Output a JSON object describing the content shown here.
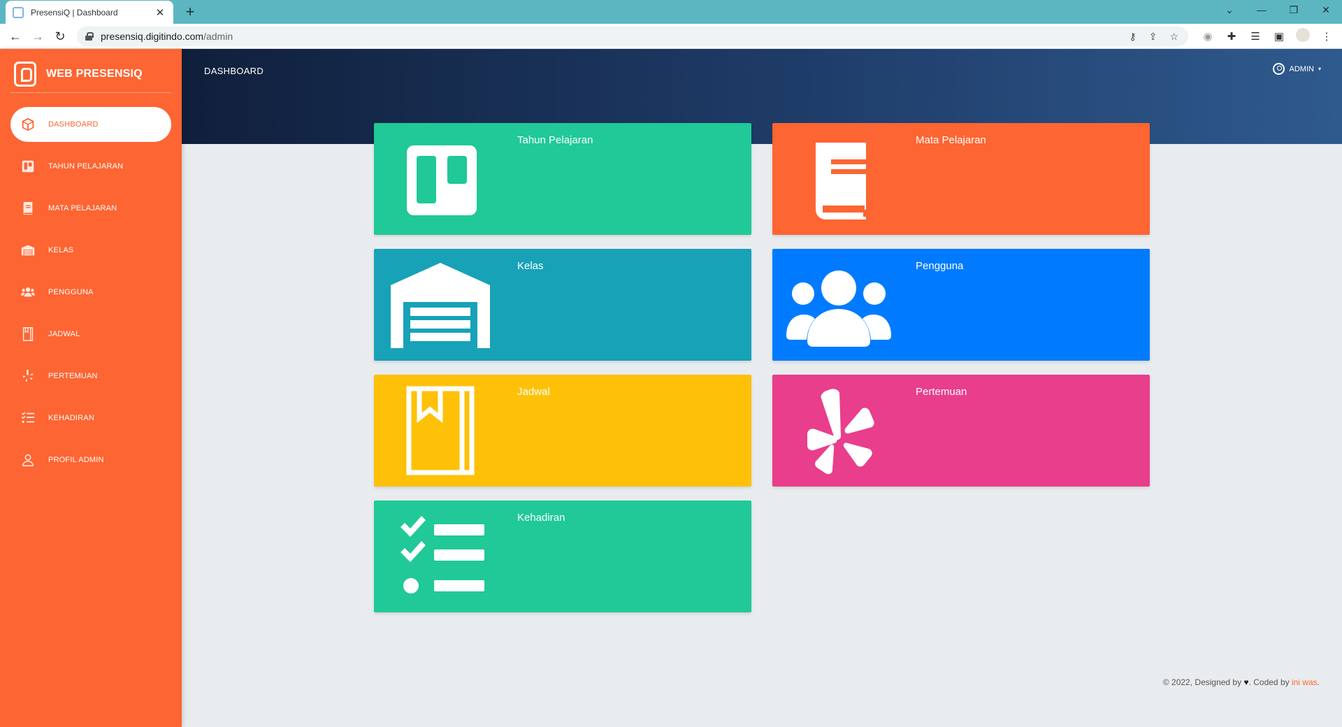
{
  "browser": {
    "tab_title": "PresensiQ | Dashboard",
    "tab_close": "✕",
    "new_tab": "+",
    "url_host": "presensiq.digitindo.com",
    "url_path": "/admin",
    "window_controls": {
      "menu": "⌄",
      "minimize": "—",
      "restore": "❐",
      "close": "✕"
    }
  },
  "brand": {
    "name": "WEB PRESENSIQ"
  },
  "sidebar": {
    "items": [
      {
        "label": "DASHBOARD",
        "icon": "cube-icon",
        "active": true
      },
      {
        "label": "TAHUN PELAJARAN",
        "icon": "trello-icon"
      },
      {
        "label": "MATA PELAJARAN",
        "icon": "book-icon"
      },
      {
        "label": "KELAS",
        "icon": "warehouse-icon"
      },
      {
        "label": "PENGGUNA",
        "icon": "users-icon"
      },
      {
        "label": "JADWAL",
        "icon": "bookmark-book-icon"
      },
      {
        "label": "PERTEMUAN",
        "icon": "yelp-icon"
      },
      {
        "label": "KEHADIRAN",
        "icon": "tasks-icon"
      },
      {
        "label": "PROFIL ADMIN",
        "icon": "user-icon"
      }
    ]
  },
  "header": {
    "title": "DASHBOARD",
    "user": "ADMIN",
    "caret": "▾"
  },
  "cards": [
    {
      "title": "Tahun Pelajaran",
      "icon": "trello-icon",
      "color": "#20c997"
    },
    {
      "title": "Mata Pelajaran",
      "icon": "book-icon",
      "color": "#fd6532"
    },
    {
      "title": "Kelas",
      "icon": "warehouse-icon",
      "color": "#17a2b8"
    },
    {
      "title": "Pengguna",
      "icon": "users-icon",
      "color": "#007bff"
    },
    {
      "title": "Jadwal",
      "icon": "bookmark-book-icon",
      "color": "#ffc107"
    },
    {
      "title": "Pertemuan",
      "icon": "yelp-icon",
      "color": "#e83e8c"
    },
    {
      "title": "Kehadiran",
      "icon": "tasks-icon",
      "color": "#20c997"
    }
  ],
  "footer": {
    "prefix": "© 2022, Designed by",
    "heart": "♥",
    "middle": ". Coded by",
    "coder": "ini was",
    "suffix": "."
  }
}
